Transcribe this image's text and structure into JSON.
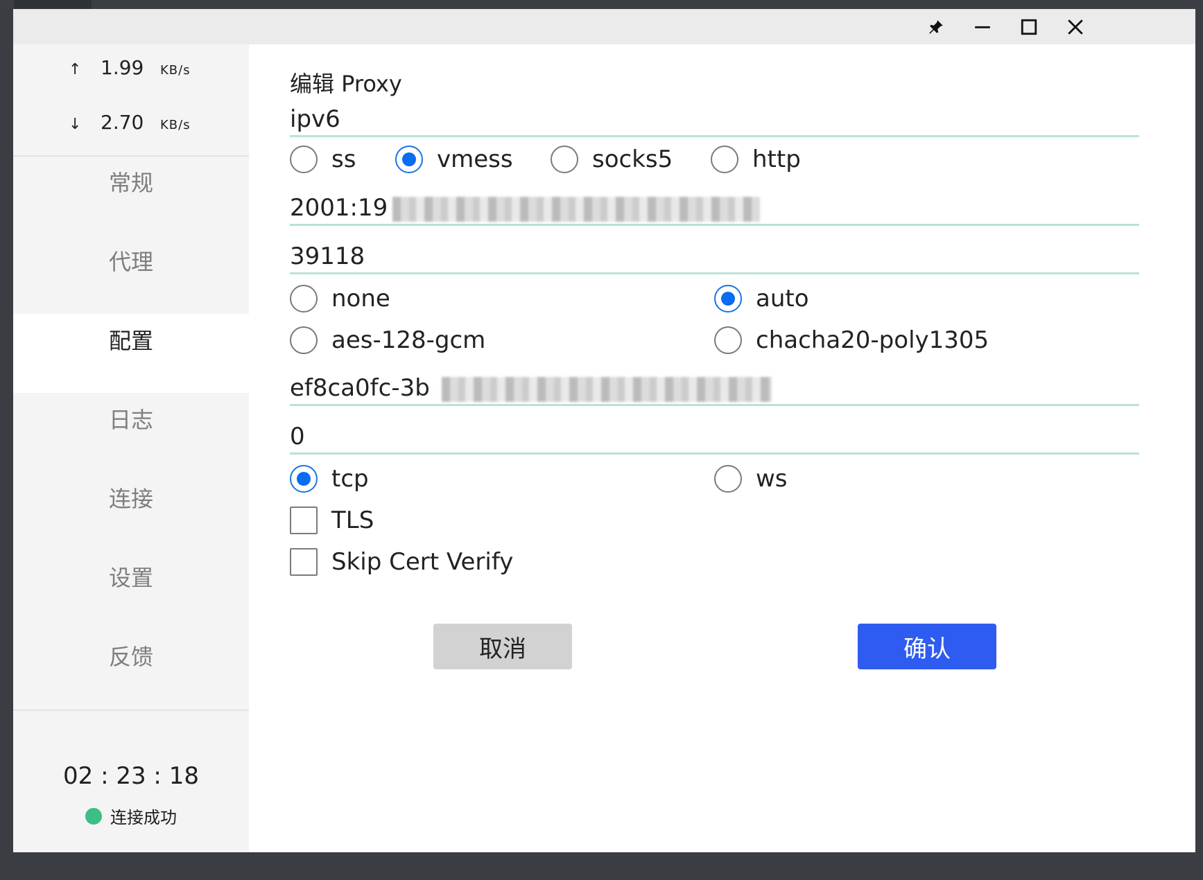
{
  "speed": {
    "upload": {
      "arrow": "↑",
      "value": "1.99",
      "unit": "KB/s"
    },
    "download": {
      "arrow": "↓",
      "value": "2.70",
      "unit": "KB/s"
    }
  },
  "nav": {
    "items": [
      {
        "label": "常规"
      },
      {
        "label": "代理"
      },
      {
        "label": "配置"
      },
      {
        "label": "日志"
      },
      {
        "label": "连接"
      },
      {
        "label": "设置"
      },
      {
        "label": "反馈"
      }
    ],
    "active": "配置"
  },
  "timer": "02 : 23 : 18",
  "status": {
    "text": "连接成功",
    "color": "#3cbf86"
  },
  "form": {
    "heading": "编辑 Proxy",
    "name": "ipv6",
    "types": [
      {
        "label": "ss",
        "checked": false
      },
      {
        "label": "vmess",
        "checked": true
      },
      {
        "label": "socks5",
        "checked": false
      },
      {
        "label": "http",
        "checked": false
      }
    ],
    "server": "2001:19",
    "port": "39118",
    "ciphers": [
      {
        "label": "none",
        "checked": false
      },
      {
        "label": "auto",
        "checked": true
      },
      {
        "label": "aes-128-gcm",
        "checked": false
      },
      {
        "label": "chacha20-poly1305",
        "checked": false
      }
    ],
    "uuid": "ef8ca0fc-3b",
    "alter_id": "0",
    "networks": [
      {
        "label": "tcp",
        "checked": true
      },
      {
        "label": "ws",
        "checked": false
      }
    ],
    "tls": {
      "label": "TLS",
      "checked": false
    },
    "skip_cert_verify": {
      "label": "Skip Cert Verify",
      "checked": false
    },
    "cancel_label": "取消",
    "confirm_label": "确认"
  },
  "colors": {
    "accent_blue": "#2f5cf0",
    "radio_blue": "#0a6cf0",
    "field_underline": "#b9e2d8"
  }
}
